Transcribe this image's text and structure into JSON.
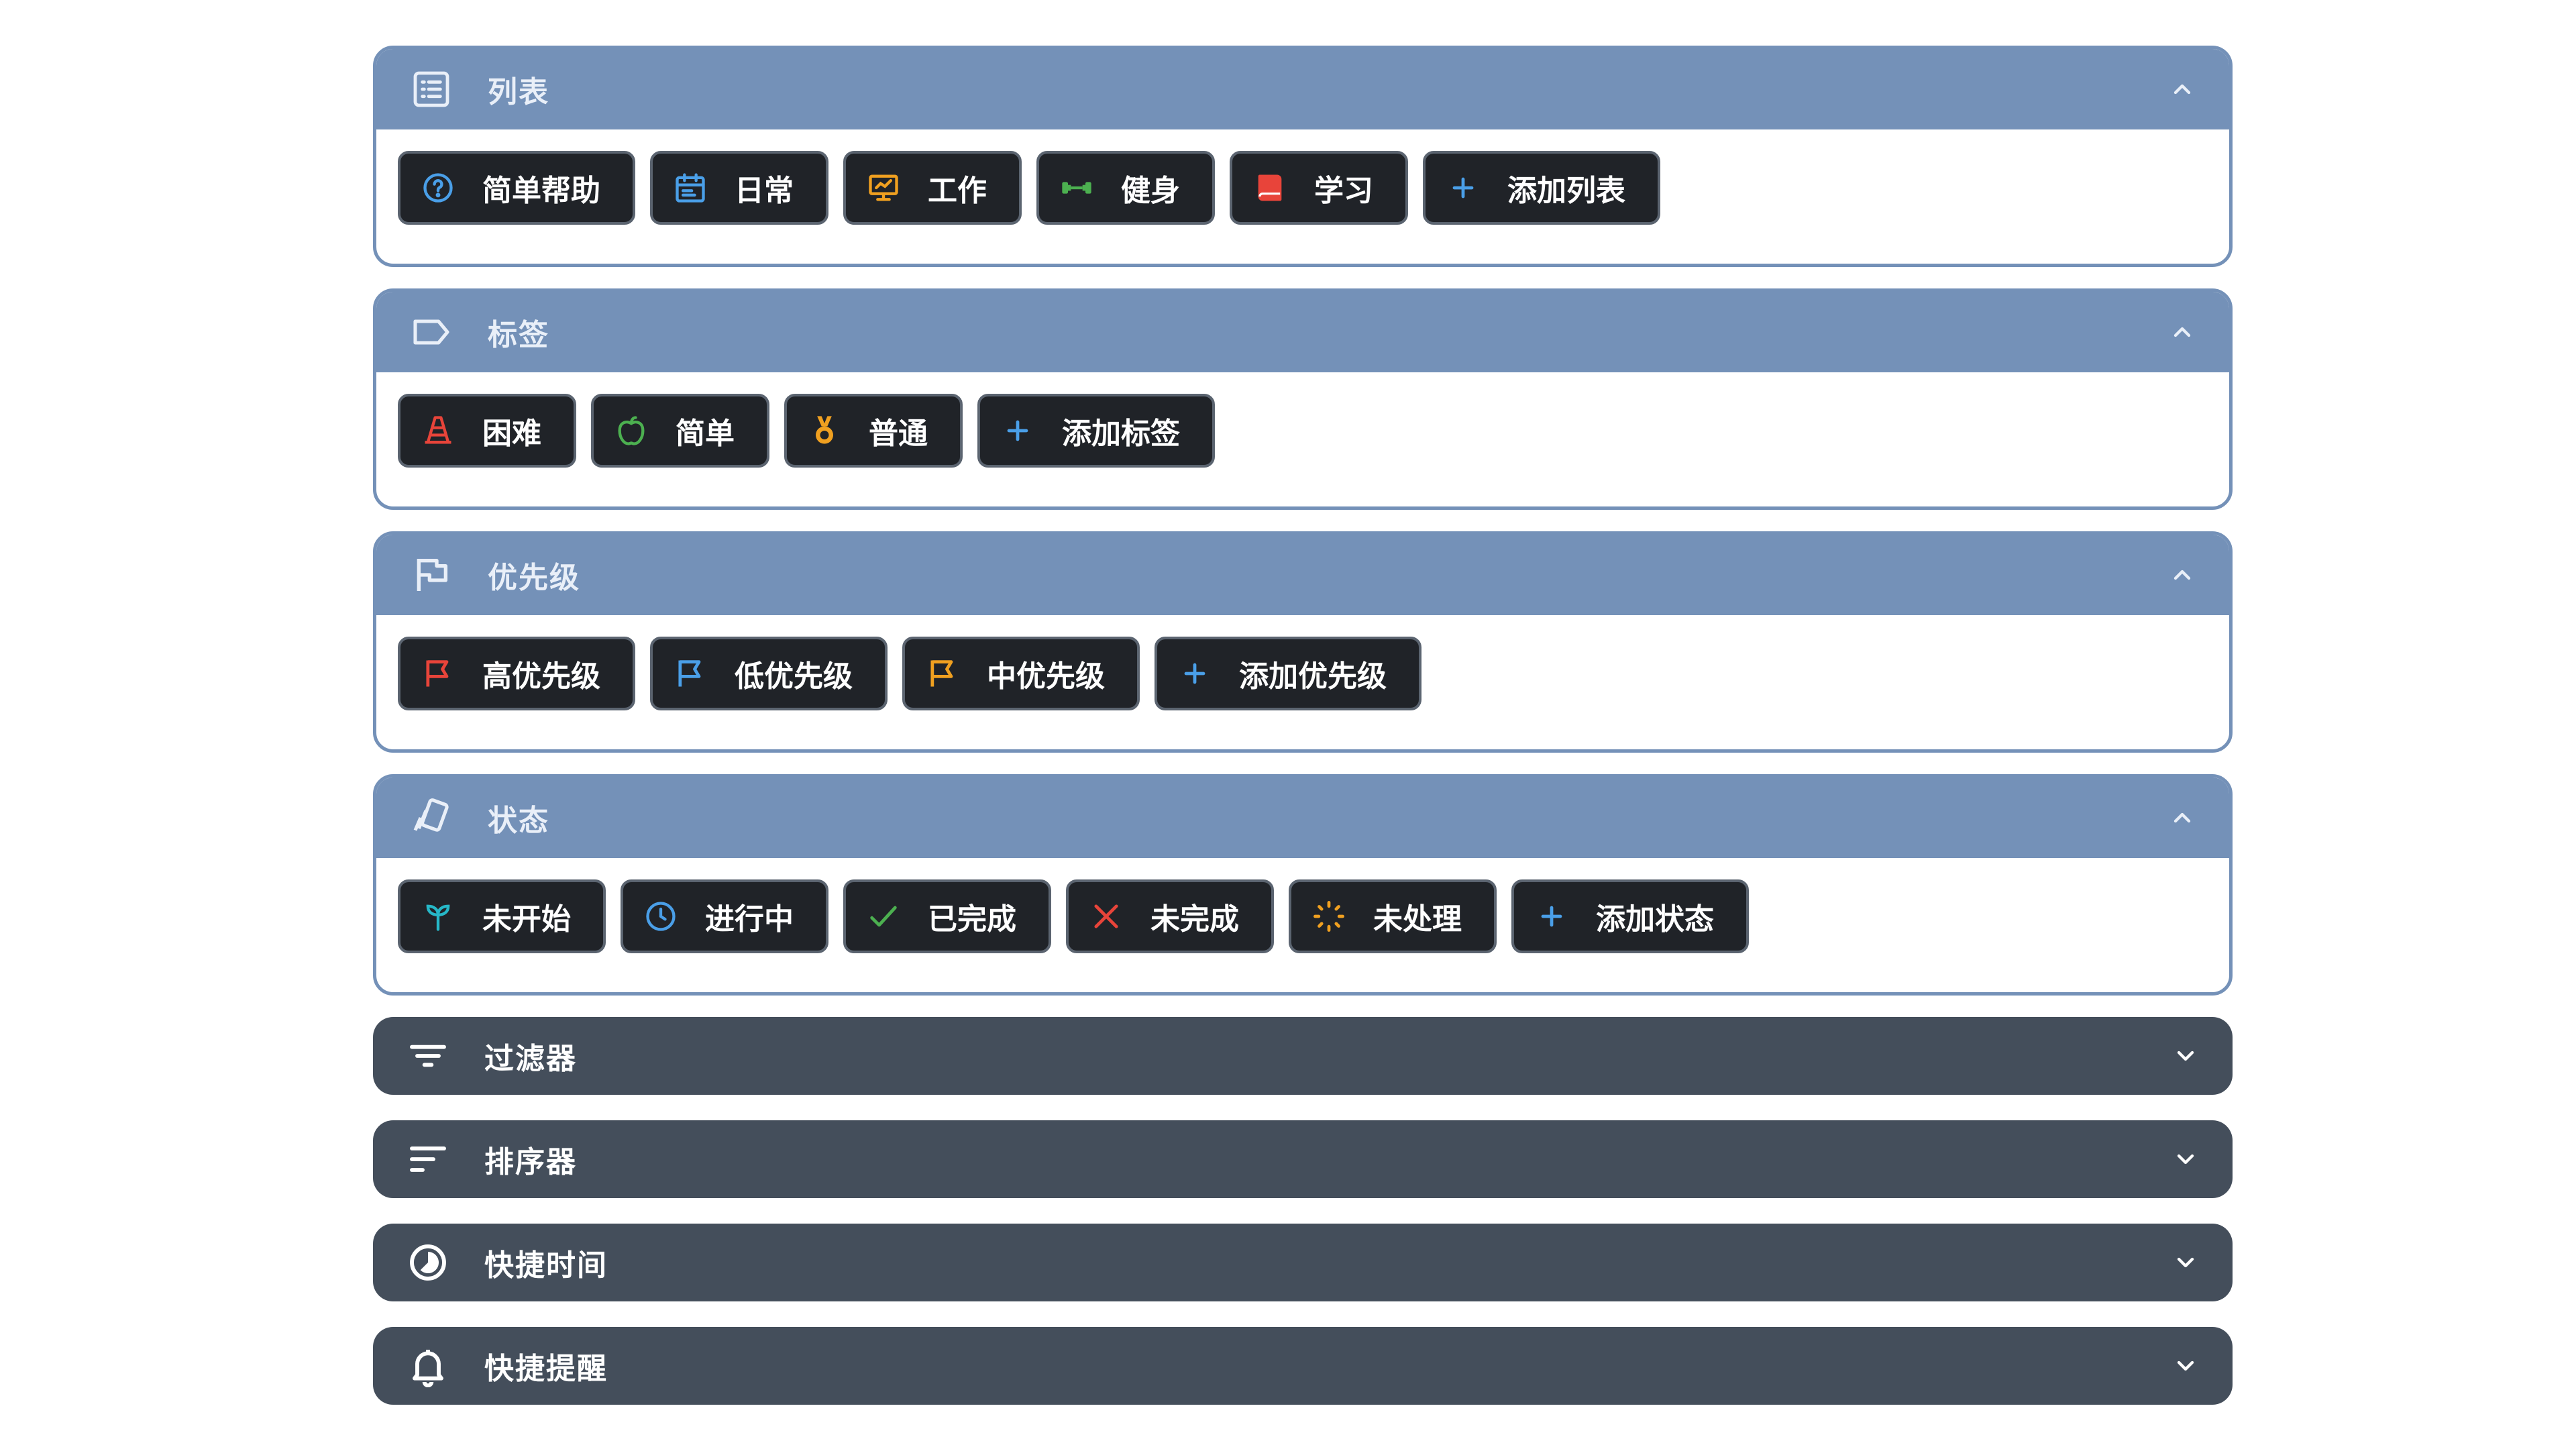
{
  "colors": {
    "open_header": "#7491b8",
    "closed_panel": "#444e5b",
    "chip_bg": "#202328",
    "chip_border": "#5b6470"
  },
  "lists": {
    "title": "列表",
    "icon": "list-icon",
    "items": [
      {
        "label": "简单帮助",
        "icon": "help-circle-icon",
        "color": "#4a9fe8"
      },
      {
        "label": "日常",
        "icon": "calendar-icon",
        "color": "#4a9fe8"
      },
      {
        "label": "工作",
        "icon": "presentation-icon",
        "color": "#f0a020"
      },
      {
        "label": "健身",
        "icon": "dumbbell-icon",
        "color": "#4cb050"
      },
      {
        "label": "学习",
        "icon": "book-icon",
        "color": "#e8443a"
      }
    ],
    "add_label": "添加列表"
  },
  "tags": {
    "title": "标签",
    "icon": "tag-icon",
    "items": [
      {
        "label": "困难",
        "icon": "cone-icon",
        "color": "#e8443a"
      },
      {
        "label": "简单",
        "icon": "apple-icon",
        "color": "#4cb050"
      },
      {
        "label": "普通",
        "icon": "medal-icon",
        "color": "#f0a020"
      }
    ],
    "add_label": "添加标签"
  },
  "priorities": {
    "title": "优先级",
    "icon": "flag-icon",
    "items": [
      {
        "label": "高优先级",
        "icon": "flag-icon",
        "color": "#e8443a"
      },
      {
        "label": "低优先级",
        "icon": "flag-icon",
        "color": "#4a9fe8"
      },
      {
        "label": "中优先级",
        "icon": "flag-icon",
        "color": "#f0a020"
      }
    ],
    "add_label": "添加优先级"
  },
  "statuses": {
    "title": "状态",
    "icon": "cards-icon",
    "items": [
      {
        "label": "未开始",
        "icon": "sprout-icon",
        "color": "#26b8c8"
      },
      {
        "label": "进行中",
        "icon": "clock-icon",
        "color": "#4a9fe8"
      },
      {
        "label": "已完成",
        "icon": "check-icon",
        "color": "#4cb050"
      },
      {
        "label": "未完成",
        "icon": "close-icon",
        "color": "#e8443a"
      },
      {
        "label": "未处理",
        "icon": "loading-icon",
        "color": "#f0a020"
      }
    ],
    "add_label": "添加状态"
  },
  "filters": {
    "title": "过滤器",
    "icon": "filter-icon"
  },
  "sorters": {
    "title": "排序器",
    "icon": "sort-icon"
  },
  "quick_time": {
    "title": "快捷时间",
    "icon": "timer-icon"
  },
  "quick_reminder": {
    "title": "快捷提醒",
    "icon": "bell-icon"
  }
}
